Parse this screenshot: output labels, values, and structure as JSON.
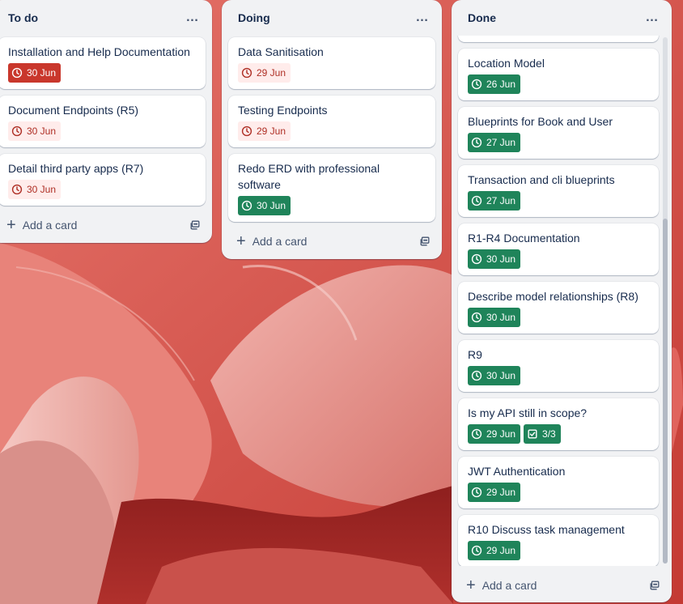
{
  "lists": [
    {
      "title": "To do",
      "cards": [
        {
          "title": "Installation and Help Documentation",
          "due": "30 Jun"
        },
        {
          "title": "Document Endpoints (R5)",
          "due": "30 Jun"
        },
        {
          "title": "Detail third party apps (R7)",
          "due": "30 Jun"
        }
      ],
      "add_label": "Add a card"
    },
    {
      "title": "Doing",
      "cards": [
        {
          "title": "Data Sanitisation",
          "due": "29 Jun"
        },
        {
          "title": "Testing Endpoints",
          "due": "29 Jun"
        },
        {
          "title": "Redo ERD with professional software",
          "due": "30 Jun"
        }
      ],
      "add_label": "Add a card"
    },
    {
      "title": "Done",
      "cards": [
        {
          "title": "Location Model",
          "due": "26 Jun"
        },
        {
          "title": "Blueprints for Book and User",
          "due": "27 Jun"
        },
        {
          "title": "Transaction and cli blueprints",
          "due": "27 Jun"
        },
        {
          "title": "R1-R4 Documentation",
          "due": "30 Jun"
        },
        {
          "title": "Describe model relationships (R8)",
          "due": "30 Jun"
        },
        {
          "title": "R9",
          "due": "30 Jun"
        },
        {
          "title": "Is my API still in scope?",
          "due": "29 Jun",
          "checklist": "3/3"
        },
        {
          "title": "JWT Authentication",
          "due": "29 Jun"
        },
        {
          "title": "R10 Discuss task management",
          "due": "29 Jun"
        }
      ],
      "add_label": "Add a card"
    }
  ],
  "list_menu_glyph": "…",
  "colors": {
    "overdue_solid": "#c9372c",
    "due_soon": "#ffeceb",
    "complete": "#1f845a"
  },
  "icons": {
    "due": "clock-icon",
    "checklist": "checklist-icon",
    "add": "plus-icon",
    "template": "card-template-icon",
    "menu": "more-options-icon"
  }
}
